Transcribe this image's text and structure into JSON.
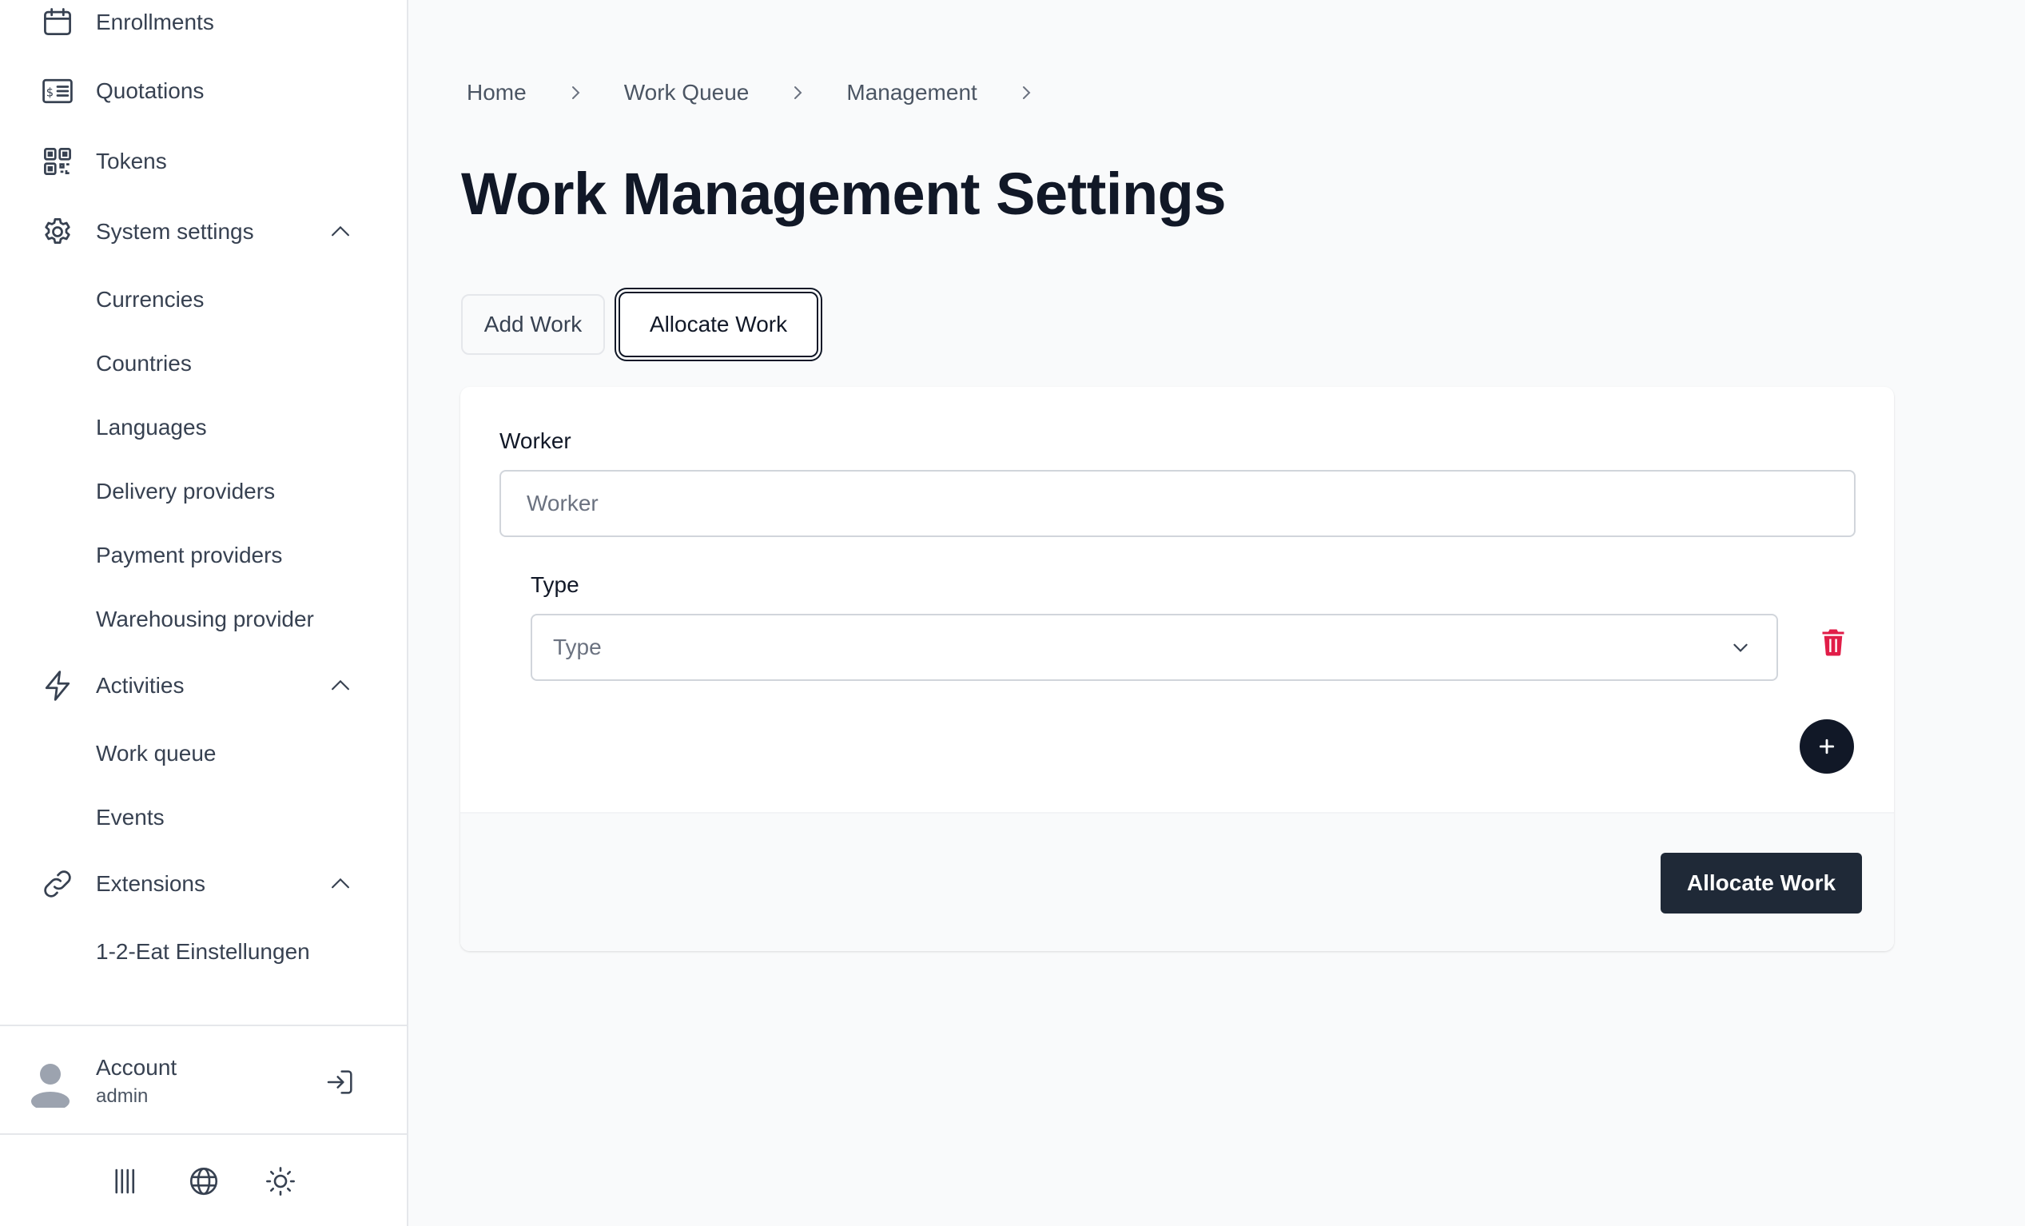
{
  "sidebar": {
    "items": [
      {
        "label": "Enrollments",
        "icon": "calendar-icon"
      },
      {
        "label": "Quotations",
        "icon": "quotation-icon"
      },
      {
        "label": "Tokens",
        "icon": "qr-code-icon"
      },
      {
        "label": "System settings",
        "icon": "gear-icon",
        "expanded": true
      },
      {
        "label": "Activities",
        "icon": "bolt-icon",
        "expanded": true
      },
      {
        "label": "Extensions",
        "icon": "link-icon",
        "expanded": true
      }
    ],
    "system_settings_children": [
      "Currencies",
      "Countries",
      "Languages",
      "Delivery providers",
      "Payment providers",
      "Warehousing provider"
    ],
    "activities_children": [
      "Work queue",
      "Events"
    ],
    "extensions_children": [
      "1-2-Eat Einstellungen"
    ],
    "account": {
      "name": "Account",
      "role": "admin"
    },
    "footer_icons": [
      "barcode-icon",
      "globe-icon",
      "sun-icon"
    ]
  },
  "breadcrumb": [
    "Home",
    "Work Queue",
    "Management"
  ],
  "page": {
    "title": "Work Management Settings"
  },
  "tabs": [
    {
      "label": "Add Work",
      "active": false
    },
    {
      "label": "Allocate Work",
      "active": true
    }
  ],
  "form": {
    "worker_label": "Worker",
    "worker_placeholder": "Worker",
    "type_label": "Type",
    "type_placeholder": "Type",
    "submit_label": "Allocate Work"
  },
  "colors": {
    "primary": "#1f2937",
    "danger": "#e11d48",
    "background": "#f9fafb",
    "text": "#111827"
  }
}
